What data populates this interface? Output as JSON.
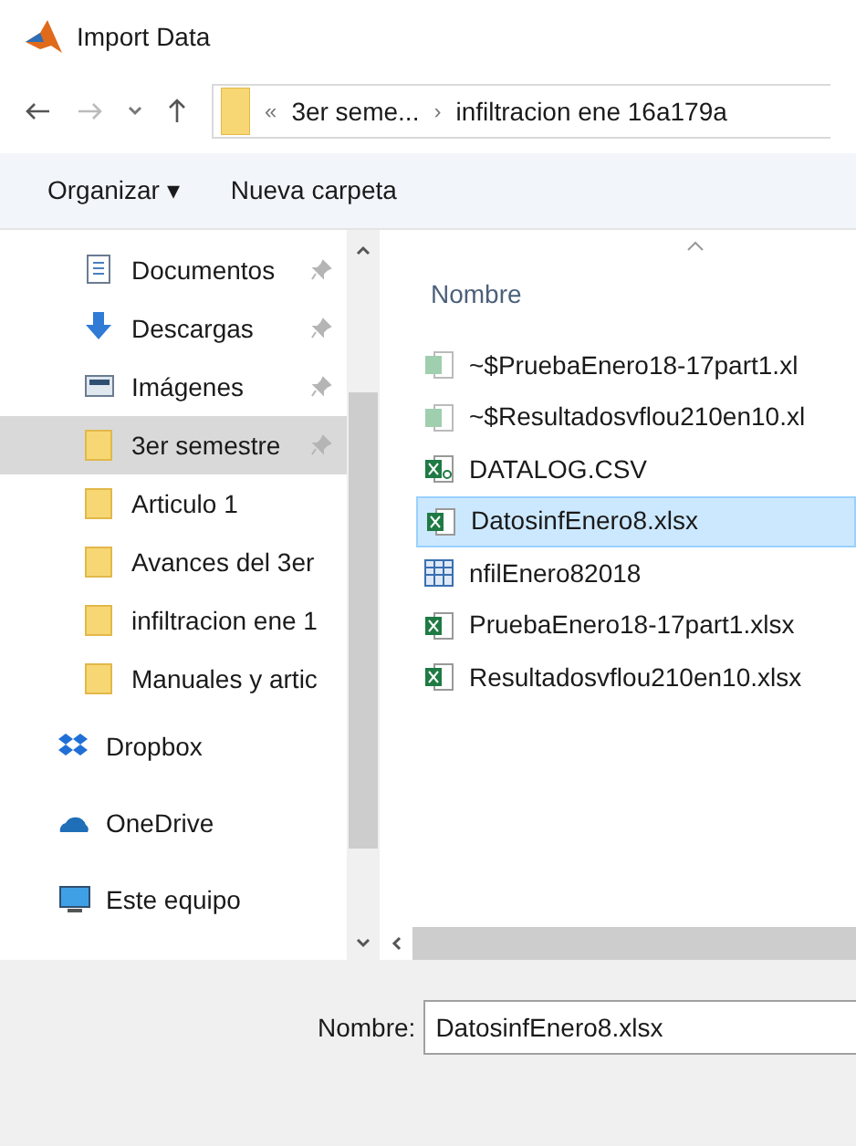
{
  "window": {
    "title": "Import Data"
  },
  "address": {
    "crumbs": [
      "«",
      "3er seme...",
      "›",
      "infiltracion ene 16a179a"
    ]
  },
  "toolbar": {
    "organize": "Organizar ▾",
    "new_folder": "Nueva carpeta"
  },
  "sidebar": {
    "items": [
      {
        "label": "Documentos",
        "kind": "documents",
        "pinned": true,
        "selected": false
      },
      {
        "label": "Descargas",
        "kind": "downloads",
        "pinned": true,
        "selected": false
      },
      {
        "label": "Imágenes",
        "kind": "pictures",
        "pinned": true,
        "selected": false
      },
      {
        "label": "3er semestre",
        "kind": "folder",
        "pinned": true,
        "selected": true
      },
      {
        "label": "Articulo 1",
        "kind": "folder",
        "pinned": false,
        "selected": false
      },
      {
        "label": "Avances del 3er",
        "kind": "folder",
        "pinned": false,
        "selected": false
      },
      {
        "label": "infiltracion ene 1",
        "kind": "folder",
        "pinned": false,
        "selected": false
      },
      {
        "label": "Manuales y artic",
        "kind": "folder",
        "pinned": false,
        "selected": false
      },
      {
        "label": "Dropbox",
        "kind": "dropbox",
        "pinned": false,
        "selected": false
      },
      {
        "label": "OneDrive",
        "kind": "onedrive",
        "pinned": false,
        "selected": false
      },
      {
        "label": "Este equipo",
        "kind": "computer",
        "pinned": false,
        "selected": false
      }
    ]
  },
  "files": {
    "column": "Nombre",
    "items": [
      {
        "name": "~$PruebaEnero18-17part1.xl",
        "kind": "excel-temp",
        "selected": false
      },
      {
        "name": "~$Resultadosvflou210en10.xl",
        "kind": "excel-temp",
        "selected": false
      },
      {
        "name": "DATALOG.CSV",
        "kind": "csv",
        "selected": false
      },
      {
        "name": "DatosinfEnero8.xlsx",
        "kind": "excel",
        "selected": true
      },
      {
        "name": "nfilEnero82018",
        "kind": "data",
        "selected": false
      },
      {
        "name": "PruebaEnero18-17part1.xlsx",
        "kind": "excel",
        "selected": false
      },
      {
        "name": "Resultadosvflou210en10.xlsx",
        "kind": "excel",
        "selected": false
      }
    ]
  },
  "filename": {
    "label": "Nombre:",
    "value": "DatosinfEnero8.xlsx"
  }
}
